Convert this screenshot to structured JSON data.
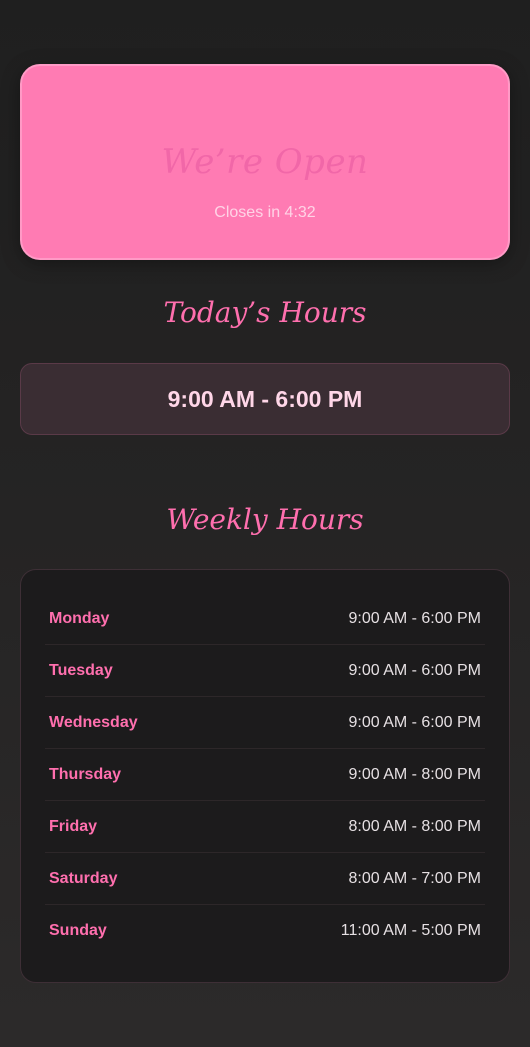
{
  "status": {
    "title": "We’re Open",
    "subtitle": "Closes in 4:32"
  },
  "today": {
    "heading": "Today’s Hours",
    "hours": "9:00 AM - 6:00 PM"
  },
  "weekly": {
    "heading": "Weekly Hours",
    "days": [
      {
        "day": "Monday",
        "hours": "9:00 AM - 6:00 PM"
      },
      {
        "day": "Tuesday",
        "hours": "9:00 AM - 6:00 PM"
      },
      {
        "day": "Wednesday",
        "hours": "9:00 AM - 6:00 PM"
      },
      {
        "day": "Thursday",
        "hours": "9:00 AM - 8:00 PM"
      },
      {
        "day": "Friday",
        "hours": "8:00 AM - 8:00 PM"
      },
      {
        "day": "Saturday",
        "hours": "8:00 AM - 7:00 PM"
      },
      {
        "day": "Sunday",
        "hours": "11:00 AM - 5:00 PM"
      }
    ]
  },
  "colors": {
    "accent": "#ff6fae",
    "card_pink": "#ff7bb3",
    "background": "#232222"
  }
}
